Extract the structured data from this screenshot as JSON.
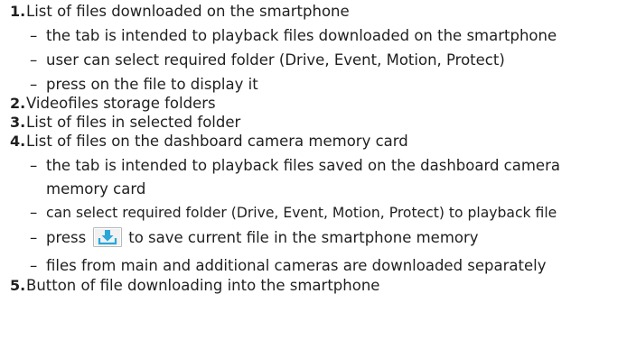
{
  "items": [
    {
      "number": "1.",
      "text": "List of files downloaded on the smartphone",
      "subs": [
        "the tab is intended to playback files downloaded on the smartphone",
        "user can select required folder (Drive, Event, Motion, Protect)",
        "press on the file to display it"
      ]
    },
    {
      "number": "2.",
      "text": "Videofiles storage folders"
    },
    {
      "number": "3.",
      "text": "List of files in selected folder"
    },
    {
      "number": "4.",
      "text": "List of files on the dashboard camera memory card",
      "subs": [
        "the tab is intended to playback files saved on the dashboard camera",
        "memory card",
        "can select required folder (Drive, Event, Motion, Protect) to playback file"
      ],
      "press_line": {
        "before": "press",
        "after": "to save current file in the smartphone memory",
        "icon": "download-icon"
      },
      "last_sub": "files from main and additional cameras are downloaded separately"
    },
    {
      "number": "5.",
      "text": "Button of file downloading into the smartphone"
    }
  ],
  "dash": "–",
  "colors": {
    "text": "#1f1f1f",
    "icon_box": "#b8b8b8",
    "icon_arrow": "#2aa6d9"
  }
}
